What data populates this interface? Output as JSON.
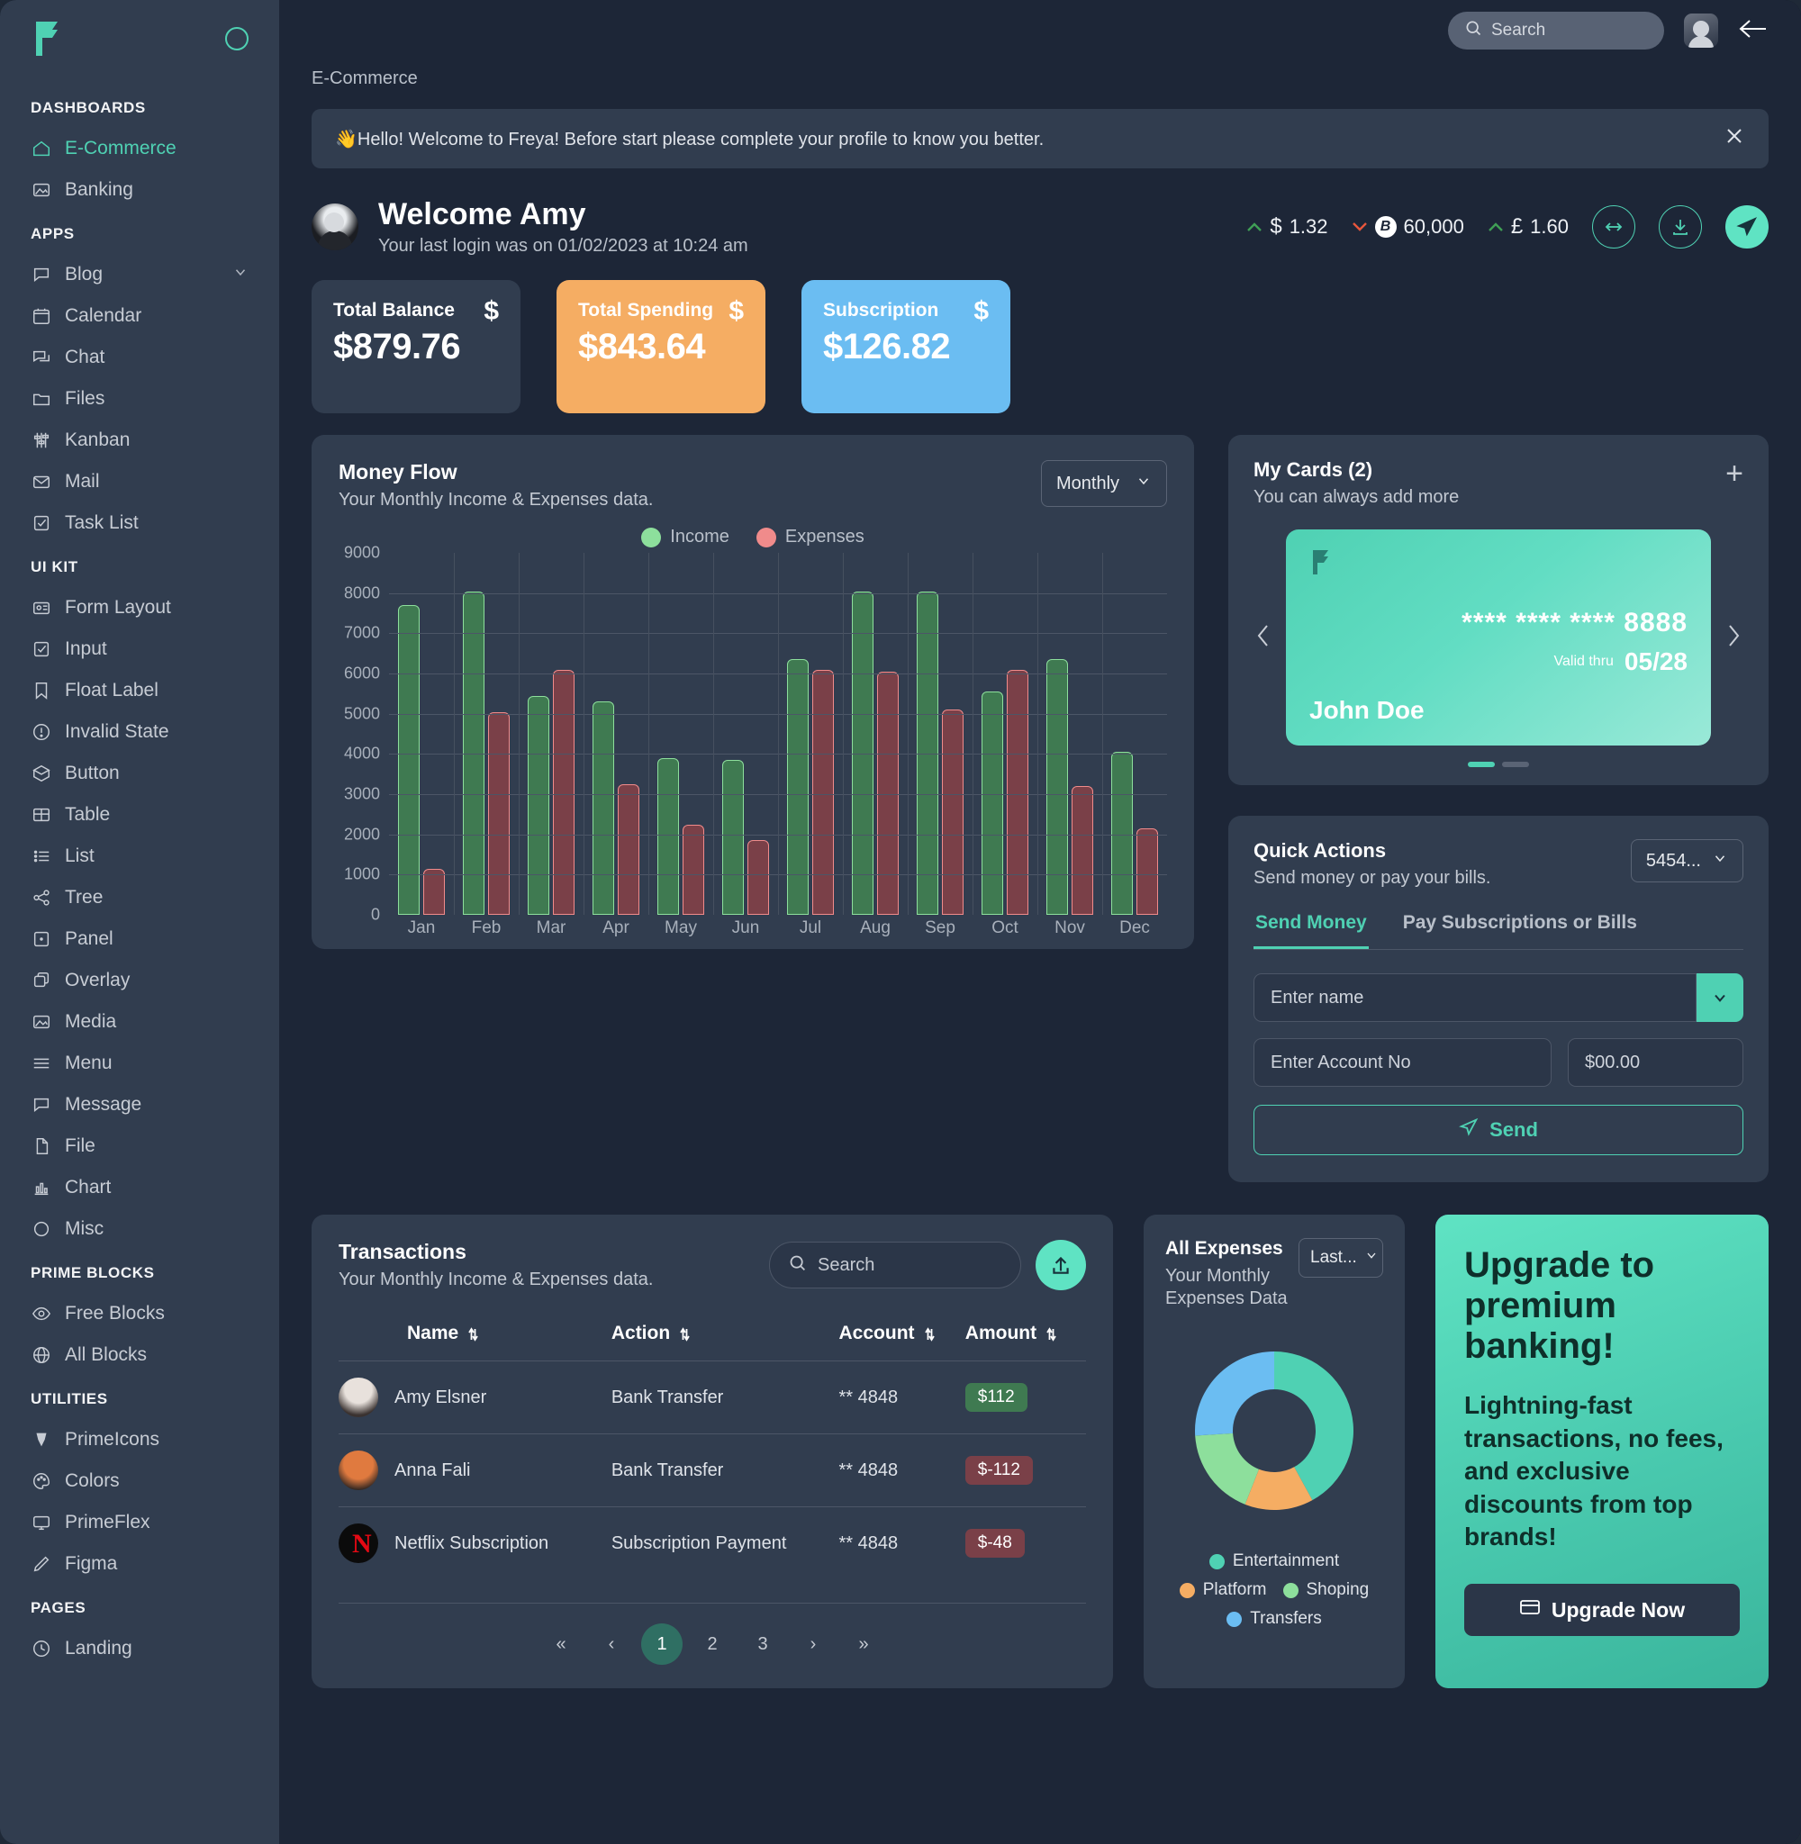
{
  "brand": {
    "name": "Freya",
    "accent": "#4fd1b3"
  },
  "topbar": {
    "search_placeholder": "Search",
    "avatar_name": "user-avatar",
    "back_label": "Back"
  },
  "breadcrumb": "E-Commerce",
  "banner": {
    "text": "👋Hello! Welcome to Freya! Before start please complete your profile to know you better."
  },
  "sidebar": {
    "sections": [
      {
        "label": "DASHBOARDS",
        "items": [
          {
            "label": "E-Commerce",
            "icon": "home-icon",
            "active": true
          },
          {
            "label": "Banking",
            "icon": "image-icon",
            "active": false
          }
        ]
      },
      {
        "label": "APPS",
        "items": [
          {
            "label": "Blog",
            "icon": "comment-icon",
            "chevron": true
          },
          {
            "label": "Calendar",
            "icon": "calendar-icon"
          },
          {
            "label": "Chat",
            "icon": "chat-icon"
          },
          {
            "label": "Files",
            "icon": "folder-icon"
          },
          {
            "label": "Kanban",
            "icon": "kanban-icon"
          },
          {
            "label": "Mail",
            "icon": "mail-icon"
          },
          {
            "label": "Task List",
            "icon": "check-square-icon"
          }
        ]
      },
      {
        "label": "UI KIT",
        "items": [
          {
            "label": "Form Layout",
            "icon": "id-card-icon"
          },
          {
            "label": "Input",
            "icon": "check-square-icon"
          },
          {
            "label": "Float Label",
            "icon": "bookmark-icon"
          },
          {
            "label": "Invalid State",
            "icon": "exclamation-circle-icon"
          },
          {
            "label": "Button",
            "icon": "box-icon"
          },
          {
            "label": "Table",
            "icon": "table-icon"
          },
          {
            "label": "List",
            "icon": "list-icon"
          },
          {
            "label": "Tree",
            "icon": "share-icon"
          },
          {
            "label": "Panel",
            "icon": "panel-icon"
          },
          {
            "label": "Overlay",
            "icon": "clone-icon"
          },
          {
            "label": "Media",
            "icon": "image-icon"
          },
          {
            "label": "Menu",
            "icon": "bars-icon"
          },
          {
            "label": "Message",
            "icon": "comment-icon"
          },
          {
            "label": "File",
            "icon": "file-icon"
          },
          {
            "label": "Chart",
            "icon": "chart-bar-icon"
          },
          {
            "label": "Misc",
            "icon": "circle-icon"
          }
        ]
      },
      {
        "label": "PRIME BLOCKS",
        "items": [
          {
            "label": "Free Blocks",
            "icon": "eye-icon"
          },
          {
            "label": "All Blocks",
            "icon": "globe-icon"
          }
        ]
      },
      {
        "label": "UTILITIES",
        "items": [
          {
            "label": "PrimeIcons",
            "icon": "prime-icon"
          },
          {
            "label": "Colors",
            "icon": "palette-icon"
          },
          {
            "label": "PrimeFlex",
            "icon": "desktop-icon"
          },
          {
            "label": "Figma",
            "icon": "pencil-icon"
          }
        ]
      },
      {
        "label": "PAGES",
        "items": [
          {
            "label": "Landing",
            "icon": "clock-icon"
          }
        ]
      }
    ]
  },
  "welcome": {
    "title": "Welcome Amy",
    "subtitle": "Your last login was on 01/02/2023 at 10:24 am",
    "tickers": [
      {
        "symbol": "$",
        "value": "1.32",
        "direction": "up"
      },
      {
        "symbol": "₿",
        "value": "60,000",
        "direction": "down"
      },
      {
        "symbol": "£",
        "value": "1.60",
        "direction": "up"
      }
    ],
    "actions": [
      {
        "name": "exchange-button",
        "icon": "arrows-h-icon"
      },
      {
        "name": "download-button",
        "icon": "download-icon"
      },
      {
        "name": "send-button",
        "icon": "send-icon"
      }
    ]
  },
  "stats": [
    {
      "label": "Total Balance",
      "value": "$879.76",
      "sign": "$",
      "style": "dark"
    },
    {
      "label": "Total Spending",
      "value": "$843.64",
      "sign": "$",
      "style": "orange"
    },
    {
      "label": "Subscription",
      "value": "$126.82",
      "sign": "$",
      "style": "blue"
    }
  ],
  "money_flow": {
    "title": "Money Flow",
    "subtitle": "Your Monthly Income & Expenses data.",
    "period": "Monthly"
  },
  "chart_data": {
    "type": "bar",
    "title": "Money Flow",
    "subtitle": "Your Monthly Income & Expenses data.",
    "xlabel": "",
    "ylabel": "",
    "ylim": [
      0,
      9000
    ],
    "yticks": [
      0,
      1000,
      2000,
      3000,
      4000,
      5000,
      6000,
      7000,
      8000,
      9000
    ],
    "grid": true,
    "legend_position": "top-center",
    "categories": [
      "Jan",
      "Feb",
      "Mar",
      "Apr",
      "May",
      "Jun",
      "Jul",
      "Aug",
      "Sep",
      "Oct",
      "Nov",
      "Dec"
    ],
    "series": [
      {
        "name": "Income",
        "color": "#8ddf9c",
        "values": [
          7700,
          8050,
          5450,
          5300,
          3900,
          3850,
          6350,
          8050,
          8050,
          5550,
          6350,
          4050
        ]
      },
      {
        "name": "Expenses",
        "color": "#f08b8b",
        "values": [
          1150,
          5050,
          6100,
          3250,
          2250,
          1850,
          6100,
          6050,
          5100,
          6100,
          3200,
          2150
        ]
      }
    ]
  },
  "my_cards": {
    "title": "My Cards (2)",
    "subtitle": "You can always add more",
    "add_label": "+",
    "card": {
      "number": "**** **** **** 8888",
      "valid_label": "Valid thru",
      "valid_value": "05/28",
      "holder": "John Doe"
    },
    "dots": [
      true,
      false
    ]
  },
  "quick_actions": {
    "title": "Quick Actions",
    "subtitle": "Send money or pay your bills.",
    "account_select": "5454...",
    "tabs": [
      {
        "label": "Send Money",
        "active": true
      },
      {
        "label": "Pay Subscriptions or Bills",
        "active": false
      }
    ],
    "name_placeholder": "Enter name",
    "account_placeholder": "Enter Account No",
    "amount_placeholder": "$00.00",
    "send_label": "Send"
  },
  "transactions": {
    "title": "Transactions",
    "subtitle": "Your Monthly Income & Expenses data.",
    "search_placeholder": "Search",
    "columns": [
      "Name",
      "Action",
      "Account",
      "Amount"
    ],
    "rows": [
      {
        "name": "Amy Elsner",
        "action": "Bank Transfer",
        "account": "** 4848",
        "amount": "$112",
        "amount_type": "pos",
        "avatar": "amy-avatar"
      },
      {
        "name": "Anna Fali",
        "action": "Bank Transfer",
        "account": "** 4848",
        "amount": "$-112",
        "amount_type": "neg",
        "avatar": "anna-avatar"
      },
      {
        "name": "Netflix Subscription",
        "action": "Subscription Payment",
        "account": "** 4848",
        "amount": "$-48",
        "amount_type": "neg",
        "avatar": "netflix-avatar"
      }
    ],
    "pagination": {
      "first": "«",
      "prev": "‹",
      "pages": [
        "1",
        "2",
        "3"
      ],
      "active": "1",
      "next": "›",
      "last": "»"
    }
  },
  "all_expenses": {
    "title": "All Expenses",
    "subtitle": "Your Monthly Expenses Data",
    "range": "Last...",
    "donut": {
      "type": "pie",
      "title": "All Expenses",
      "labels": [
        "Entertainment",
        "Platform",
        "Shoping",
        "Transfers"
      ],
      "colors": [
        "#4fd1b3",
        "#f5ad63",
        "#8ddf9c",
        "#6bbdf2"
      ],
      "values": [
        42,
        14,
        18,
        26
      ]
    },
    "legend": [
      {
        "label": "Entertainment",
        "color": "#4fd1b3"
      },
      {
        "label": "Platform",
        "color": "#f5ad63"
      },
      {
        "label": "Shoping",
        "color": "#8ddf9c"
      },
      {
        "label": "Transfers",
        "color": "#6bbdf2"
      }
    ]
  },
  "promo": {
    "heading": "Upgrade to premium banking!",
    "body": "Lightning-fast transactions, no fees, and exclusive discounts from top brands!",
    "button": "Upgrade Now"
  }
}
